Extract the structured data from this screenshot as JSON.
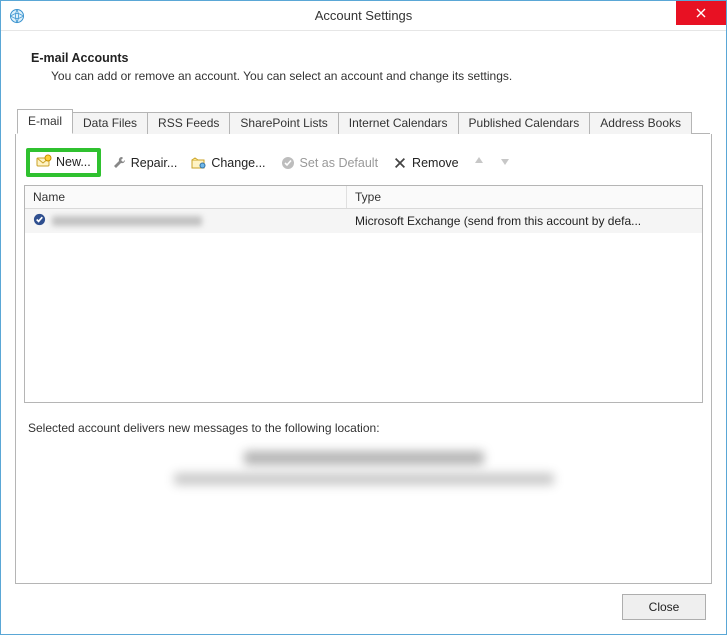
{
  "window": {
    "title": "Account Settings",
    "close_icon": "close"
  },
  "header": {
    "title": "E-mail Accounts",
    "subtitle": "You can add or remove an account. You can select an account and change its settings."
  },
  "tabs": [
    {
      "label": "E-mail",
      "active": true
    },
    {
      "label": "Data Files",
      "active": false
    },
    {
      "label": "RSS Feeds",
      "active": false
    },
    {
      "label": "SharePoint Lists",
      "active": false
    },
    {
      "label": "Internet Calendars",
      "active": false
    },
    {
      "label": "Published Calendars",
      "active": false
    },
    {
      "label": "Address Books",
      "active": false
    }
  ],
  "toolbar": {
    "new_label": "New...",
    "repair_label": "Repair...",
    "change_label": "Change...",
    "set_default_label": "Set as Default",
    "remove_label": "Remove"
  },
  "list": {
    "columns": {
      "name": "Name",
      "type": "Type"
    },
    "rows": [
      {
        "name_redacted": true,
        "type": "Microsoft Exchange (send from this account by defa..."
      }
    ]
  },
  "footer": {
    "delivery_text": "Selected account delivers new messages to the following location:"
  },
  "buttons": {
    "close": "Close"
  }
}
